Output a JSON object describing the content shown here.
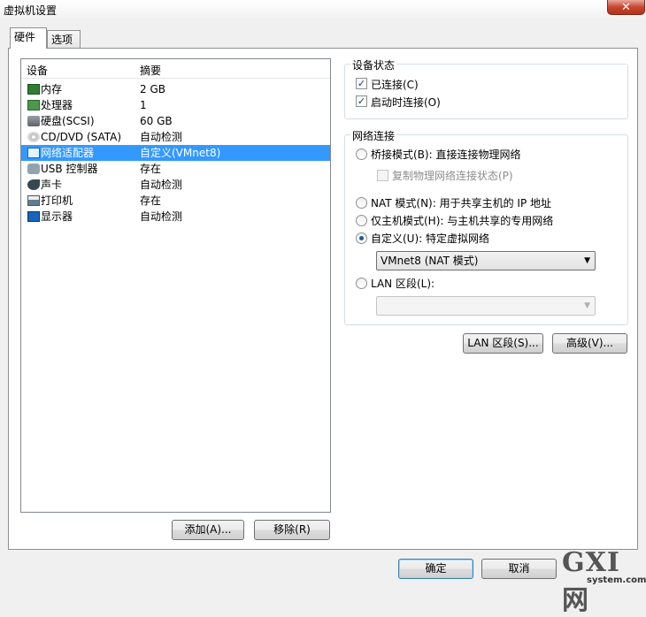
{
  "window": {
    "title": "虚拟机设置",
    "close_glyph": "✕"
  },
  "tabs": [
    {
      "label": "硬件",
      "active": true
    },
    {
      "label": "选项",
      "active": false
    }
  ],
  "device_list": {
    "columns": [
      "设备",
      "摘要"
    ],
    "rows": [
      {
        "name": "内存",
        "summary": "2 GB",
        "icon": "memory-icon"
      },
      {
        "name": "处理器",
        "summary": "1",
        "icon": "cpu-icon"
      },
      {
        "name": "硬盘(SCSI)",
        "summary": "60 GB",
        "icon": "hard-disk-icon"
      },
      {
        "name": "CD/DVD (SATA)",
        "summary": "自动检测",
        "icon": "cd-dvd-icon"
      },
      {
        "name": "网络适配器",
        "summary": "自定义(VMnet8)",
        "icon": "network-adapter-icon",
        "selected": true
      },
      {
        "name": "USB 控制器",
        "summary": "存在",
        "icon": "usb-icon"
      },
      {
        "name": "声卡",
        "summary": "自动检测",
        "icon": "sound-card-icon"
      },
      {
        "name": "打印机",
        "summary": "存在",
        "icon": "printer-icon"
      },
      {
        "name": "显示器",
        "summary": "自动检测",
        "icon": "display-icon"
      }
    ],
    "add_label": "添加(A)...",
    "remove_label": "移除(R)"
  },
  "device_status": {
    "title": "设备状态",
    "connected": {
      "label": "已连接(C)",
      "checked": true
    },
    "connect_at_power_on": {
      "label": "启动时连接(O)",
      "checked": true
    }
  },
  "network": {
    "title": "网络连接",
    "bridged": {
      "label": "桥接模式(B): 直接连接物理网络",
      "checked": false
    },
    "replicate": {
      "label": "复制物理网络连接状态(P)",
      "checked": false
    },
    "nat": {
      "label": "NAT 模式(N): 用于共享主机的 IP 地址",
      "checked": false
    },
    "host_only": {
      "label": "仅主机模式(H): 与主机共享的专用网络",
      "checked": false
    },
    "custom": {
      "label": "自定义(U): 特定虚拟网络",
      "checked": true
    },
    "custom_value": "VMnet8 (NAT 模式)",
    "lan_segment": {
      "label": "LAN 区段(L):",
      "checked": false
    },
    "lan_value": "",
    "lan_segments_button": "LAN 区段(S)...",
    "advanced_button": "高级(V)...",
    "arrow_glyph": "▼"
  },
  "footer": {
    "ok_label": "确定",
    "cancel_label": "取消"
  },
  "watermark": {
    "text": "GXI网",
    "sub": "system.com"
  },
  "colors": {
    "selection": "#3399ff",
    "radio_dot": "#1d5a9b",
    "close": "#c7462e"
  }
}
